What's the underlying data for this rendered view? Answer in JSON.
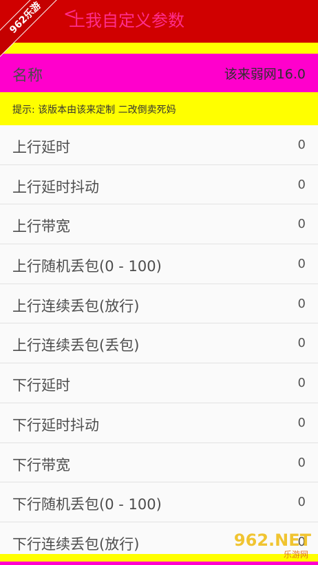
{
  "header": {
    "back_glyph": "<",
    "title": "上我自定义参数"
  },
  "name_row": {
    "label": "名称",
    "value": "该来弱网16.0"
  },
  "hint": {
    "text": "提示: 该版本由该来定制  二改倒卖死妈"
  },
  "items": [
    {
      "label": "上行延时",
      "value": "0"
    },
    {
      "label": "上行延时抖动",
      "value": "0"
    },
    {
      "label": "上行带宽",
      "value": "0"
    },
    {
      "label": "上行随机丢包(0 - 100)",
      "value": "0"
    },
    {
      "label": "上行连续丢包(放行)",
      "value": "0"
    },
    {
      "label": "上行连续丢包(丢包)",
      "value": "0"
    },
    {
      "label": "下行延时",
      "value": "0"
    },
    {
      "label": "下行延时抖动",
      "value": "0"
    },
    {
      "label": "下行带宽",
      "value": "0"
    },
    {
      "label": "下行随机丢包(0 - 100)",
      "value": "0"
    },
    {
      "label": "下行连续丢包(放行)",
      "value": "0"
    }
  ],
  "watermarks": {
    "corner": "962乐游",
    "logo_top": "962.NET",
    "logo_bottom": "乐游网"
  },
  "colors": {
    "titlebar": "#d00000",
    "title_text": "#ff2d8c",
    "yellow": "#ffff00",
    "magenta": "#ff00cc"
  }
}
